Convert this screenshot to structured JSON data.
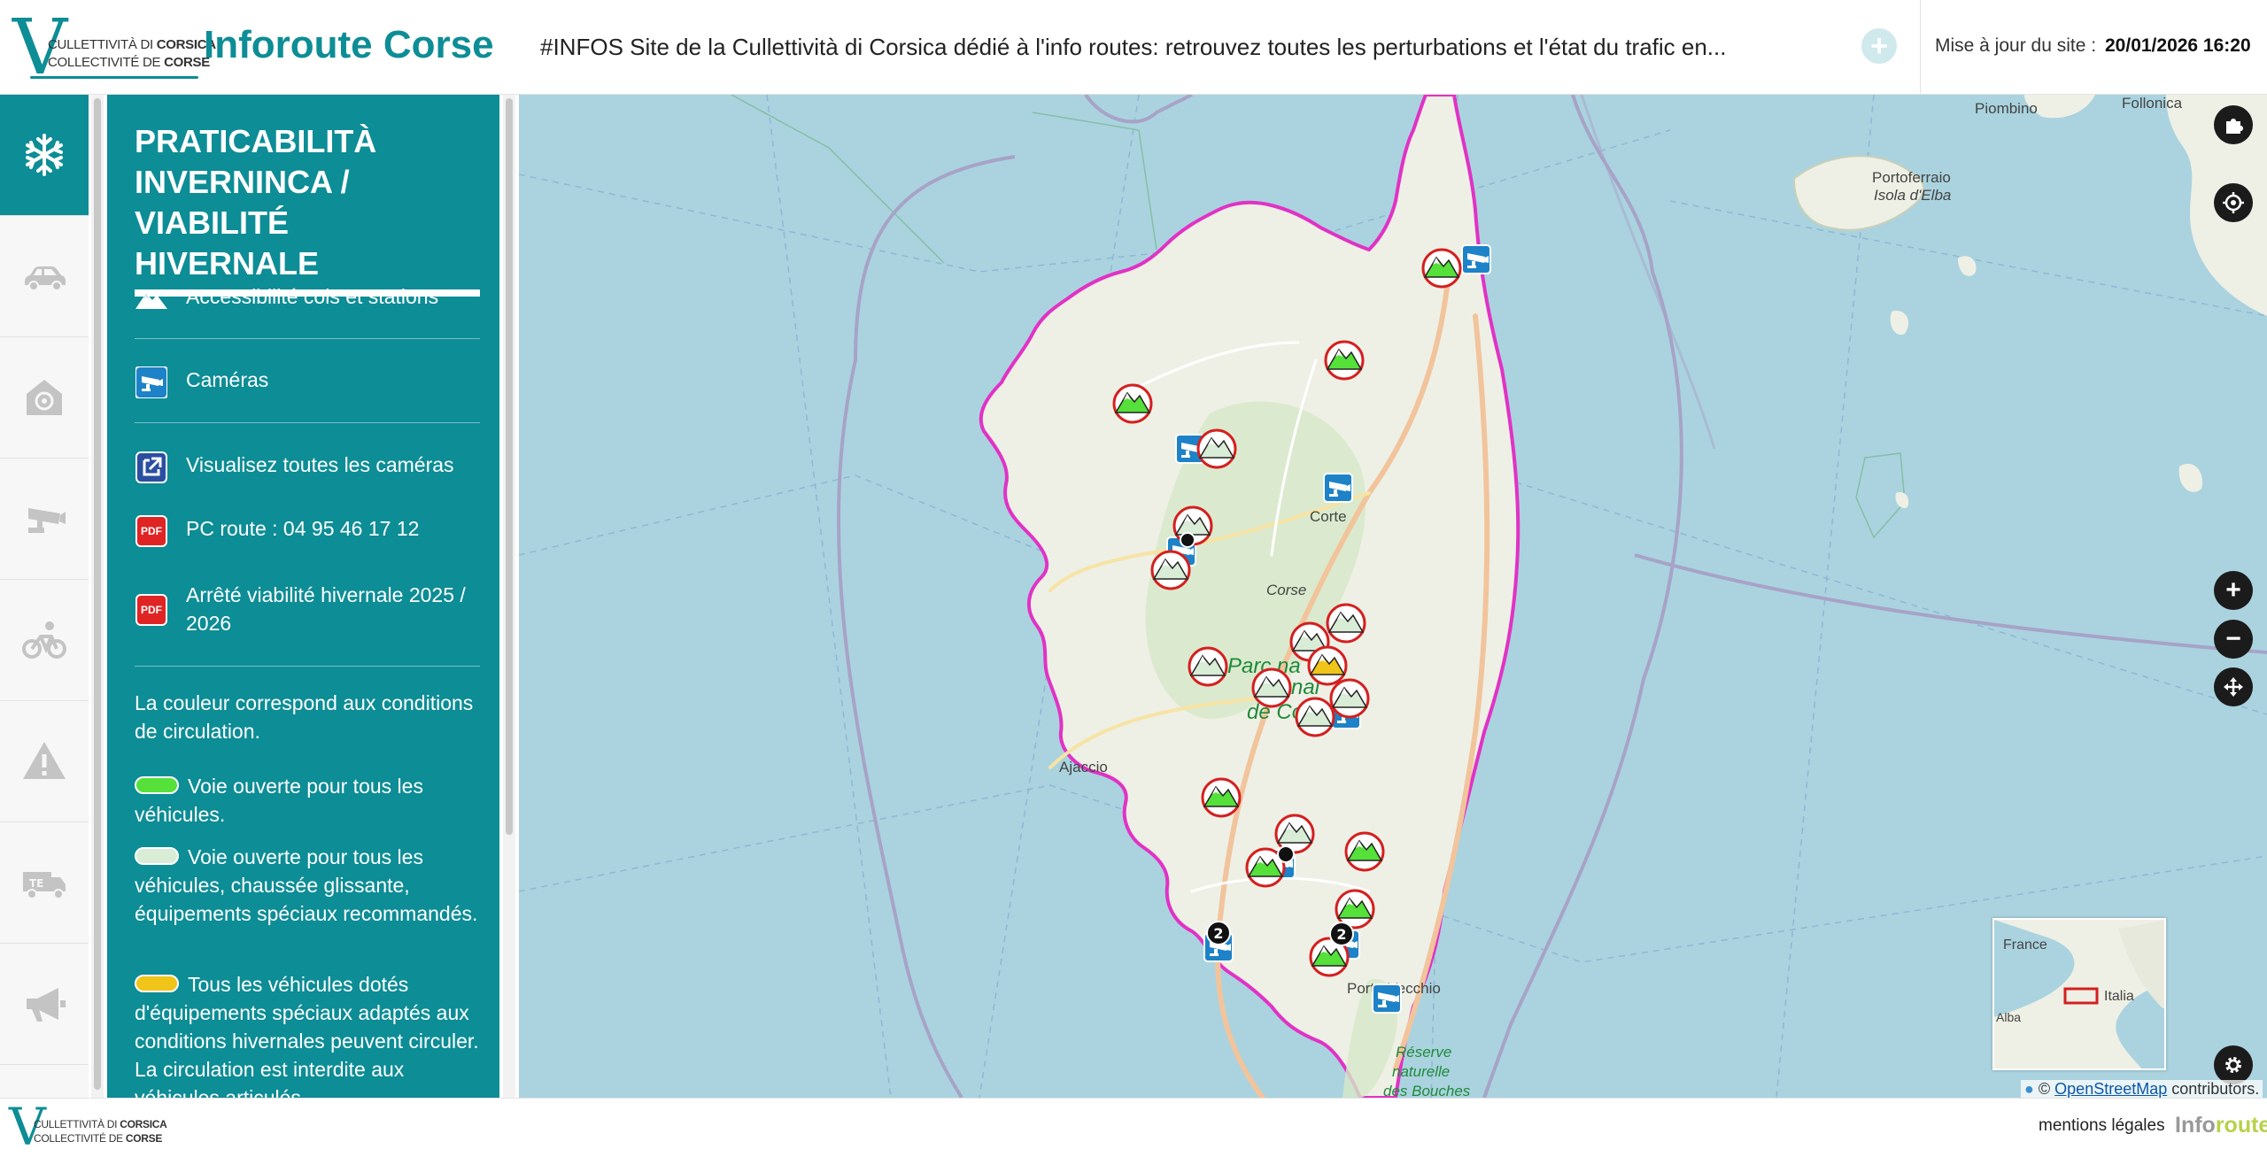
{
  "header": {
    "logo": {
      "line1_prefix": "CULLETTIVITÀ DI",
      "line1_bold": "CORSICA",
      "line2_prefix": "COLLECTIVITÉ DE",
      "line2_bold": "CORSE"
    },
    "brand": "Inforoute Corse",
    "ticker": "#INFOS  Site de la Cullettività di Corsica dédié à l'info routes: retrouvez toutes les perturbations et l'état du trafic en...",
    "update_label": "Mise à jour du site :",
    "update_value": "20/01/2026 16:20"
  },
  "nav": {
    "items": [
      {
        "name": "winter",
        "icon": "snowflake-icon",
        "active": true
      },
      {
        "name": "traffic",
        "icon": "car-icon",
        "active": false
      },
      {
        "name": "alerts",
        "icon": "mail-alert-icon",
        "active": false
      },
      {
        "name": "cameras",
        "icon": "camera-icon",
        "active": false
      },
      {
        "name": "cycling",
        "icon": "bicycle-icon",
        "active": false
      },
      {
        "name": "warnings",
        "icon": "warning-icon",
        "active": false
      },
      {
        "name": "transport",
        "icon": "truck-icon",
        "active": false
      },
      {
        "name": "announcements",
        "icon": "megaphone-icon",
        "active": false
      }
    ]
  },
  "panel": {
    "title": "PRATICABILITÀ INVERNINCA / VIABILITÉ HIVERNALE",
    "items": [
      {
        "label": "Accessibilité cols et stations",
        "icon": "mountain-icon"
      },
      {
        "label": "Caméras",
        "icon": "camera-icon"
      },
      {
        "label": "Visualisez toutes les caméras",
        "icon": "external-link-icon"
      },
      {
        "label": "PC route : 04 95 46 17 12",
        "icon": "pdf-icon"
      },
      {
        "label": "Arrêté viabilité hivernale 2025 / 2026",
        "icon": "pdf-icon"
      }
    ],
    "pdf_label": "PDF",
    "legend_intro": "La couleur correspond aux conditions de circulation.",
    "legend": [
      {
        "color": "#55e03a",
        "text": "Voie ouverte pour tous les véhicules."
      },
      {
        "color": "#d9ecd6",
        "text": "Voie ouverte pour tous les véhicules, chaussée glissante, équipements spéciaux recommandés."
      },
      {
        "color": "#f0c419",
        "text": "Tous les véhicules dotés d'équipements spéciaux adaptés aux conditions hivernales peuvent circuler. La circulation est interdite aux véhicules articulés."
      }
    ]
  },
  "map": {
    "labels": {
      "piombino": "Piombino",
      "follonica": "Follonica",
      "portoferraio": "Portoferraio",
      "elba": "Isola d'Elba",
      "corte": "Corte",
      "corse": "Corse",
      "park_line1": "Parc na",
      "park_line2": "nal",
      "park_line3": "de Co",
      "ajaccio": "Ajaccio",
      "porto_vecchio": "Porto-Vecchio",
      "reserve_line1": "Réserve",
      "reserve_line2": "naturelle",
      "reserve_line3": "des Bouches",
      "cluster_count": "2"
    },
    "zoom_in": "+",
    "zoom_out": "−",
    "minimap_labels": {
      "france": "France",
      "italia": "Italia",
      "alba": "Alba"
    },
    "attribution_prefix": "©",
    "attribution_link": "OpenStreetMap",
    "attribution_suffix": "contributors.",
    "colors": {
      "land": "#eef0e5",
      "sea": "#aad3df",
      "border": "#e132c5",
      "open": "#55e03a",
      "slippery": "#d9ecd6",
      "equipment": "#f0c419",
      "camera": "#1d82c7"
    }
  },
  "footer": {
    "mentions": "mentions légales",
    "logo_info": "Info",
    "logo_route": "route"
  }
}
